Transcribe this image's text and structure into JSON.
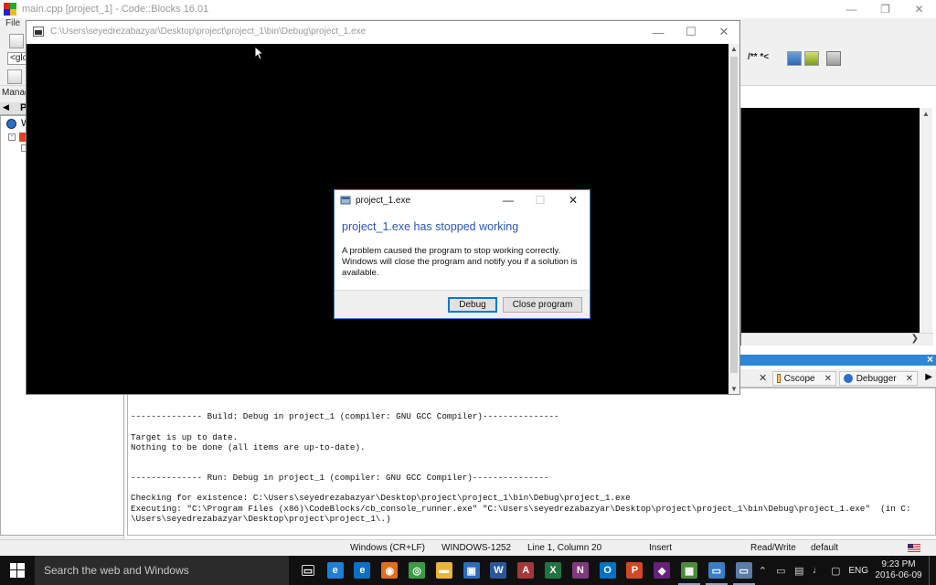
{
  "codeblocks": {
    "window_title": "main.cpp [project_1] - Code::Blocks 16.01",
    "menu_file": "File",
    "toolbar_combo_text": "<glo",
    "toolbar_comment_text": "/** *<",
    "management_title": "Managem",
    "management_tab": "P",
    "tree_item": "W",
    "logs_close": "×",
    "log_tabs": [
      {
        "label": "Cscope"
      },
      {
        "label": "Debugger"
      }
    ],
    "build_log": [
      "-------------- Build: Debug in project_1 (compiler: GNU GCC Compiler)---------------",
      "",
      "Target is up to date.",
      "Nothing to be done (all items are up-to-date).",
      "",
      "",
      "-------------- Run: Debug in project_1 (compiler: GNU GCC Compiler)---------------",
      "",
      "Checking for existence: C:\\Users\\seyedrezabazyar\\Desktop\\project\\project_1\\bin\\Debug\\project_1.exe",
      "Executing: \"C:\\Program Files (x86)\\CodeBlocks/cb_console_runner.exe\" \"C:\\Users\\seyedrezabazyar\\Desktop\\project\\project_1\\bin\\Debug\\project_1.exe\"  (in C:",
      "\\Users\\seyedrezabazyar\\Desktop\\project\\project_1\\.)"
    ],
    "status": {
      "line_ending": "Windows (CR+LF)",
      "encoding": "WINDOWS-1252",
      "position": "Line 1, Column 20",
      "mode": "Insert",
      "access": "Read/Write",
      "profile": "default"
    }
  },
  "console": {
    "title": "C:\\Users\\seyedrezabazyar\\Desktop\\project\\project_1\\bin\\Debug\\project_1.exe"
  },
  "dialog": {
    "title": "project_1.exe",
    "heading": "project_1.exe has stopped working",
    "message": "A problem caused the program to stop working correctly. Windows will close the program and notify you if a solution is available.",
    "debug_label": "Debug",
    "close_label": "Close program"
  },
  "taskbar": {
    "search_placeholder": "Search the web and Windows",
    "apps": [
      {
        "icon": "task-view-icon",
        "glyph": "▭",
        "color": "transparent"
      },
      {
        "icon": "internet-explorer-icon",
        "glyph": "e",
        "color": "#1e7fd6"
      },
      {
        "icon": "edge-icon",
        "glyph": "e",
        "color": "#0a6fc2"
      },
      {
        "icon": "firefox-icon",
        "glyph": "◉",
        "color": "#e36c1d"
      },
      {
        "icon": "chrome-icon",
        "glyph": "◎",
        "color": "#3a9b45"
      },
      {
        "icon": "file-explorer-icon",
        "glyph": "▬",
        "color": "#e9b43c"
      },
      {
        "icon": "store-icon",
        "glyph": "▣",
        "color": "#2d6bb8"
      },
      {
        "icon": "word-icon",
        "glyph": "W",
        "color": "#2b579a"
      },
      {
        "icon": "access-icon",
        "glyph": "A",
        "color": "#a4373a"
      },
      {
        "icon": "excel-icon",
        "glyph": "X",
        "color": "#217346"
      },
      {
        "icon": "onenote-icon",
        "glyph": "N",
        "color": "#80397b"
      },
      {
        "icon": "outlook-icon",
        "glyph": "O",
        "color": "#0072c6"
      },
      {
        "icon": "powerpoint-icon",
        "glyph": "P",
        "color": "#d24726"
      },
      {
        "icon": "visual-studio-icon",
        "glyph": "◆",
        "color": "#68217a"
      },
      {
        "icon": "codeblocks-icon",
        "glyph": "▦",
        "color": "#4d8a3a"
      },
      {
        "icon": "remote-desktop-icon",
        "glyph": "▭",
        "color": "#3b7cc4"
      },
      {
        "icon": "project-console-icon",
        "glyph": "▭",
        "color": "#5a7da8"
      }
    ],
    "language": "ENG",
    "time": "9:23 PM",
    "date": "2016-06-09"
  }
}
